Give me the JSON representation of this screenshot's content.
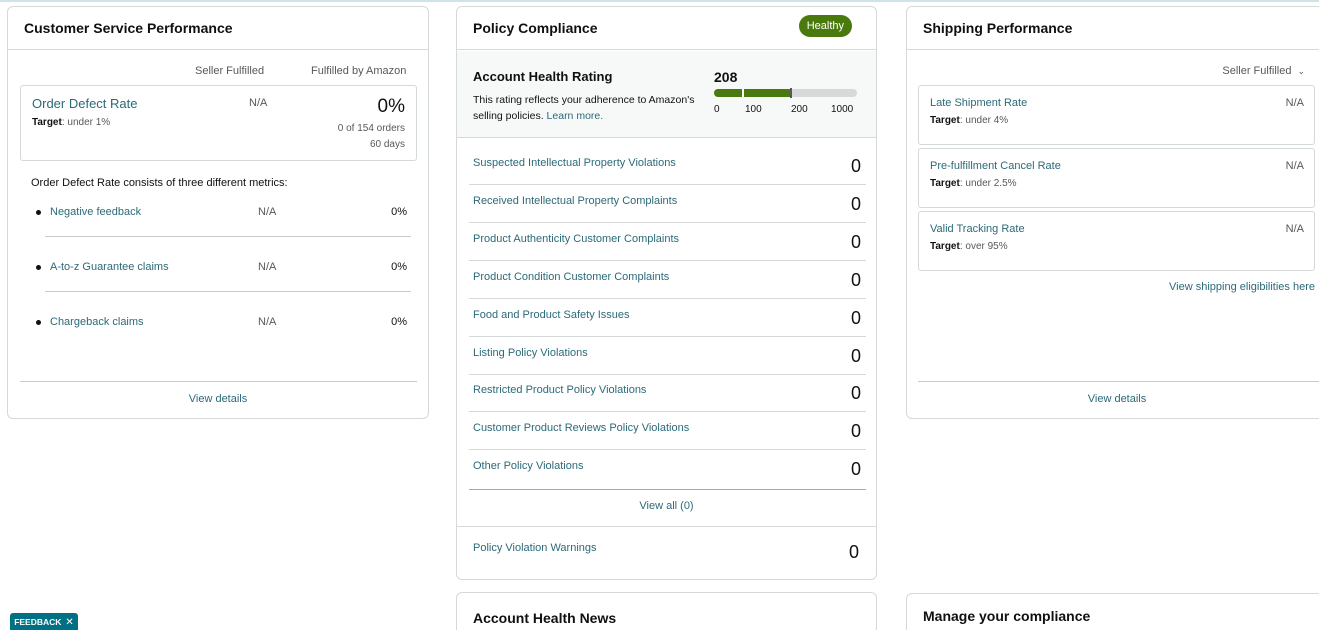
{
  "customer_service": {
    "title": "Customer Service Performance",
    "col_seller": "Seller Fulfilled",
    "col_amazon": "Fulfilled by Amazon",
    "odr": {
      "name": "Order Defect Rate",
      "target_label": "Target",
      "target_value": ": under 1%",
      "seller_value": "N/A",
      "amazon_value": "0%",
      "orders": "0 of 154 orders",
      "days": "60 days"
    },
    "consists_text": "Order Defect Rate consists of three different metrics:",
    "metrics": [
      {
        "name": "Negative feedback",
        "seller": "N/A",
        "amazon": "0%"
      },
      {
        "name": "A-to-z Guarantee claims",
        "seller": "N/A",
        "amazon": "0%"
      },
      {
        "name": "Chargeback claims",
        "seller": "N/A",
        "amazon": "0%"
      }
    ],
    "view_details": "View details"
  },
  "policy_compliance": {
    "title": "Policy Compliance",
    "badge": "Healthy",
    "status_color": "#4a7a0e",
    "ahr": {
      "title": "Account Health Rating",
      "desc": "This rating reflects your adherence to Amazon's selling policies.",
      "learn_more": "Learn more.",
      "score": "208",
      "scale_max": 1000,
      "ticks": [
        "0",
        "100",
        "200",
        "1000"
      ]
    },
    "violations": [
      {
        "name": "Suspected Intellectual Property Violations",
        "count": "0"
      },
      {
        "name": "Received Intellectual Property Complaints",
        "count": "0"
      },
      {
        "name": "Product Authenticity Customer Complaints",
        "count": "0"
      },
      {
        "name": "Product Condition Customer Complaints",
        "count": "0"
      },
      {
        "name": "Food and Product Safety Issues",
        "count": "0"
      },
      {
        "name": "Listing Policy Violations",
        "count": "0"
      },
      {
        "name": "Restricted Product Policy Violations",
        "count": "0"
      },
      {
        "name": "Customer Product Reviews Policy Violations",
        "count": "0"
      },
      {
        "name": "Other Policy Violations",
        "count": "0"
      }
    ],
    "view_all": "View all (0)",
    "warnings": {
      "name": "Policy Violation Warnings",
      "count": "0"
    }
  },
  "shipping": {
    "title": "Shipping Performance",
    "filter": "Seller Fulfilled",
    "metrics": [
      {
        "name": "Late Shipment Rate",
        "target_label": "Target",
        "target_value": ": under 4%",
        "value": "N/A"
      },
      {
        "name": "Pre-fulfillment Cancel Rate",
        "target_label": "Target",
        "target_value": ": under 2.5%",
        "value": "N/A"
      },
      {
        "name": "Valid Tracking Rate",
        "target_label": "Target",
        "target_value": ": over 95%",
        "value": "N/A"
      }
    ],
    "eligibilities_link": "View shipping eligibilities here",
    "view_details": "View details"
  },
  "account_health_news": {
    "title": "Account Health News"
  },
  "manage_compliance": {
    "title": "Manage your compliance"
  },
  "feedback": {
    "label": "FEEDBACK",
    "close": "✕"
  }
}
